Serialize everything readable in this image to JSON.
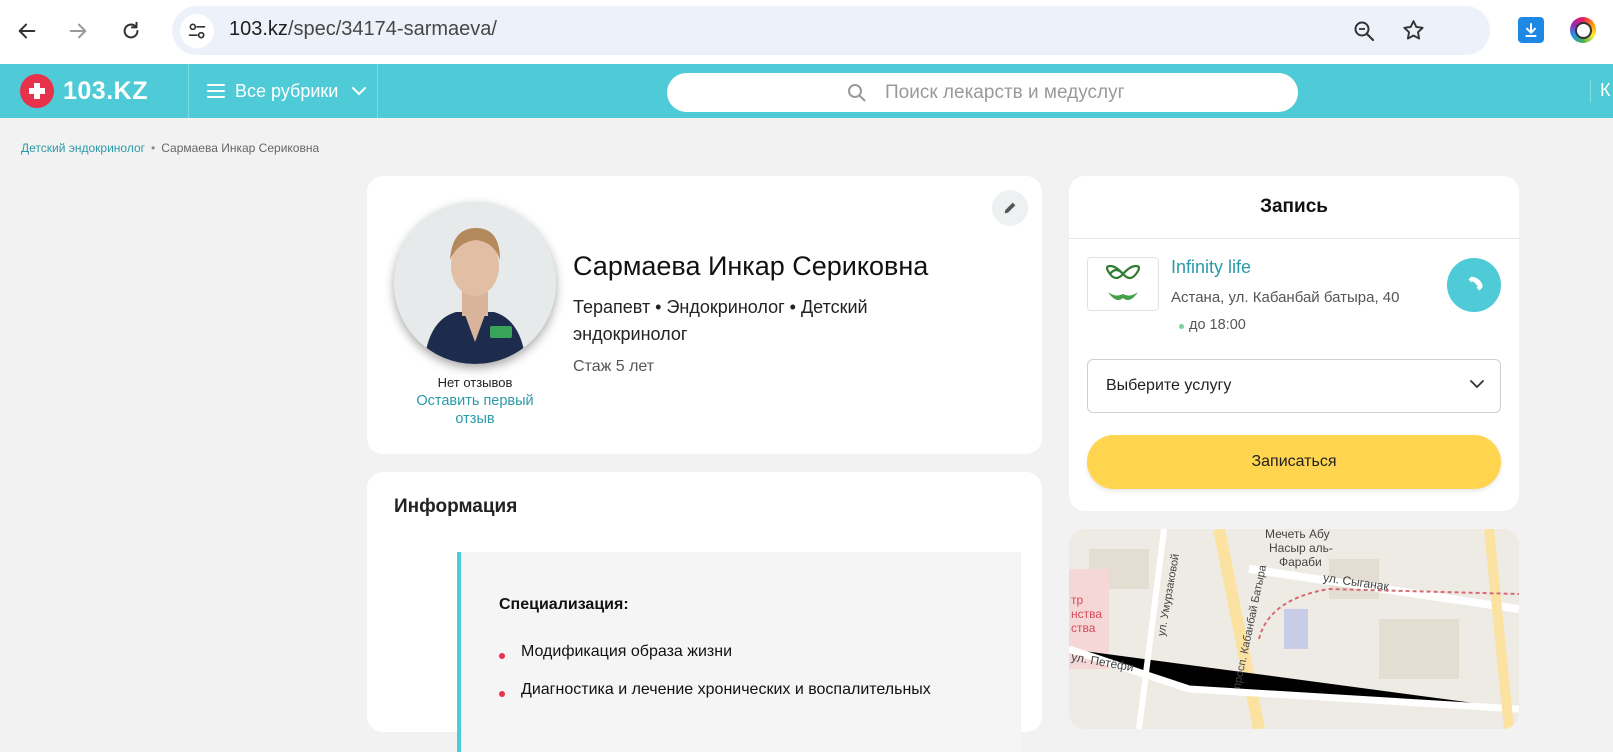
{
  "browser": {
    "url_domain": "103.kz",
    "url_path": "/spec/34174-sarmaeva/"
  },
  "header": {
    "logo_text": "103.KZ",
    "rubrics_label": "Все рубрики",
    "search_placeholder": "Поиск лекарств и медуслуг",
    "right_fragment": "К"
  },
  "breadcrumb": {
    "parent": "Детский эндокринолог",
    "separator": "•",
    "current": "Сармаева Инкар Сериковна"
  },
  "profile": {
    "name": "Сармаева Инкар Сериковна",
    "specialties": "Терапевт • Эндокринолог • Детский эндокринолог",
    "experience": "Стаж 5 лет",
    "no_reviews": "Нет отзывов",
    "leave_review": "Оставить первый отзыв"
  },
  "info": {
    "title": "Информация",
    "spec_heading": "Специализация:",
    "items": [
      "Модификация образа жизни",
      "Диагностика и лечение хронических и воспалительных"
    ]
  },
  "booking": {
    "title": "Запись",
    "clinic_name": "Infinity life",
    "clinic_address": "Астана, ул. Кабанбай батыра, 40",
    "clinic_hours": "до 18:00",
    "service_placeholder": "Выберите услугу",
    "book_button": "Записаться"
  },
  "map": {
    "labels": [
      "Мечеть Абу",
      "Насыр аль-",
      "Фараби",
      "ул. Сыганак",
      "ул. Умурзаковой",
      "просп. Кабанбай Батыра",
      "ул. Петёфи",
      "тр",
      "нства",
      "ства"
    ]
  },
  "colors": {
    "header_bg": "#4ecbd6",
    "accent_teal": "#2a9aa8",
    "logo_red": "#e8314a",
    "book_button": "#ffd54f"
  },
  "icons": [
    "back-arrow-icon",
    "forward-arrow-icon",
    "reload-icon",
    "site-info-icon",
    "zoom-icon",
    "bookmark-star-icon",
    "download-icon",
    "extension-icon",
    "logo-cross-icon",
    "menu-icon",
    "chevron-down-icon",
    "search-icon",
    "edit-pencil-icon",
    "phone-icon",
    "infinity-logo-icon"
  ]
}
